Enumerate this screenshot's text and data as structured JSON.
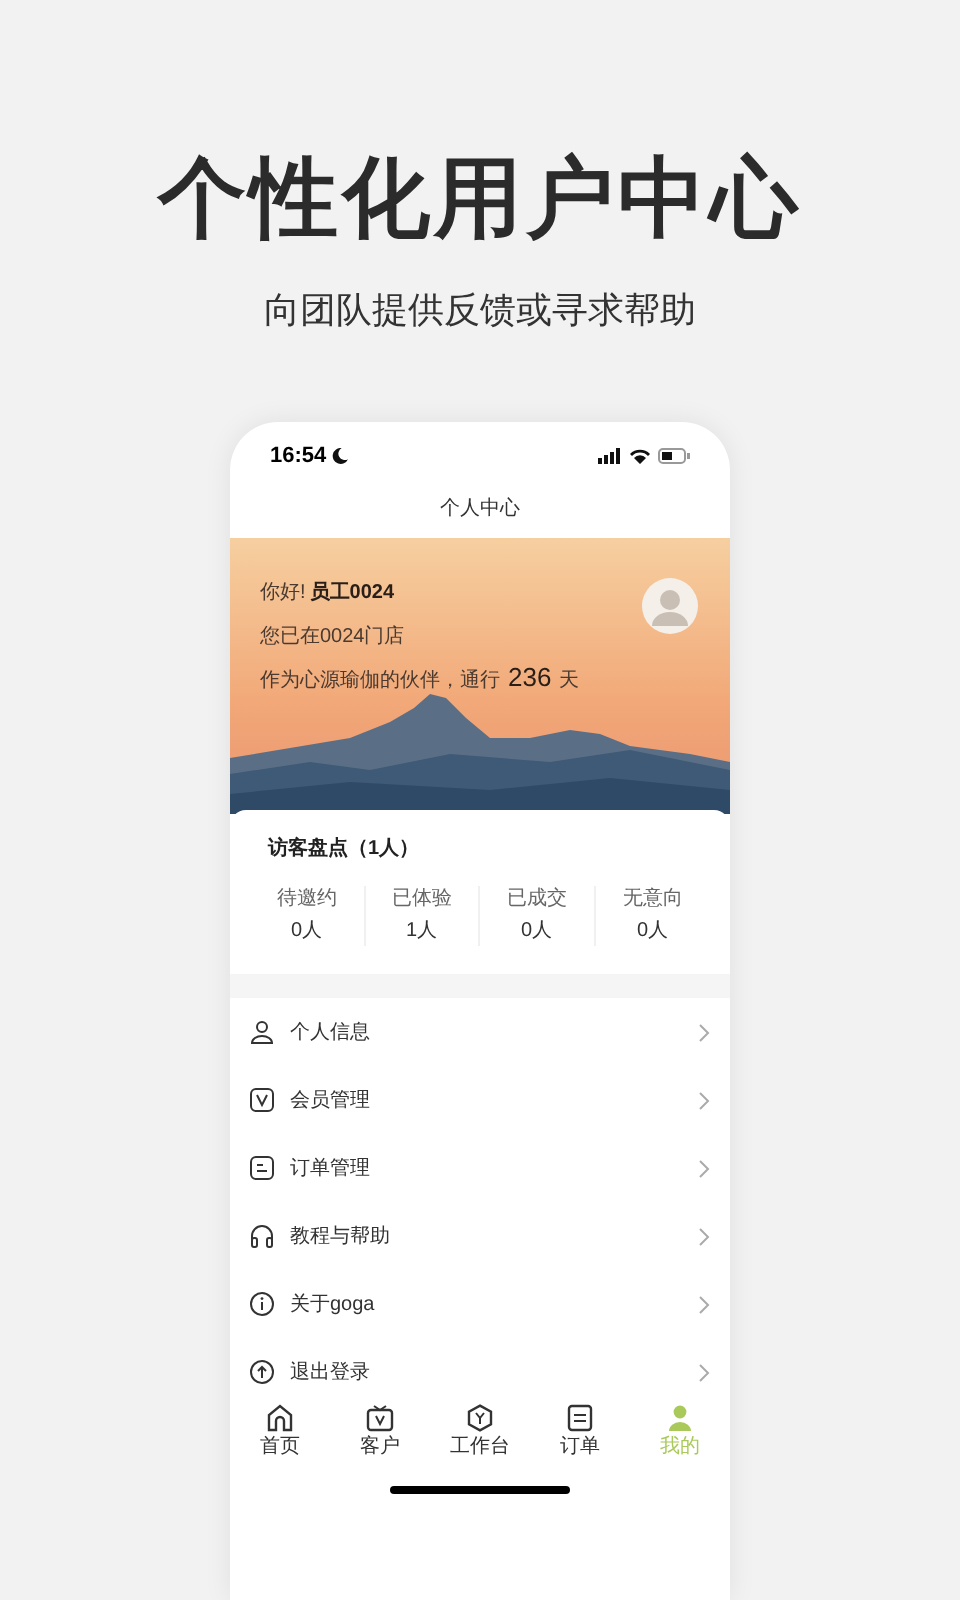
{
  "headline": "个性化用户中心",
  "subtitle": "向团队提供反馈或寻求帮助",
  "status_bar": {
    "time": "16:54"
  },
  "page_title": "个人中心",
  "profile": {
    "greeting": "你好!",
    "name": "员工0024",
    "store_line": "您已在0024门店",
    "partner_line": "作为心源瑜伽的伙伴，通行",
    "days": "236",
    "days_unit": "天"
  },
  "visitor_summary": {
    "title": "访客盘点（1人）",
    "stats": [
      {
        "label": "待邀约",
        "value": "0人"
      },
      {
        "label": "已体验",
        "value": "1人"
      },
      {
        "label": "已成交",
        "value": "0人"
      },
      {
        "label": "无意向",
        "value": "0人"
      }
    ]
  },
  "menu": [
    {
      "label": "个人信息"
    },
    {
      "label": "会员管理"
    },
    {
      "label": "订单管理"
    },
    {
      "label": "教程与帮助"
    },
    {
      "label": "关于goga"
    },
    {
      "label": "退出登录"
    }
  ],
  "tab_bar": [
    {
      "label": "首页",
      "selected": false
    },
    {
      "label": "客户",
      "selected": false
    },
    {
      "label": "工作台",
      "selected": false
    },
    {
      "label": "订单",
      "selected": false
    },
    {
      "label": "我的",
      "selected": true
    }
  ]
}
